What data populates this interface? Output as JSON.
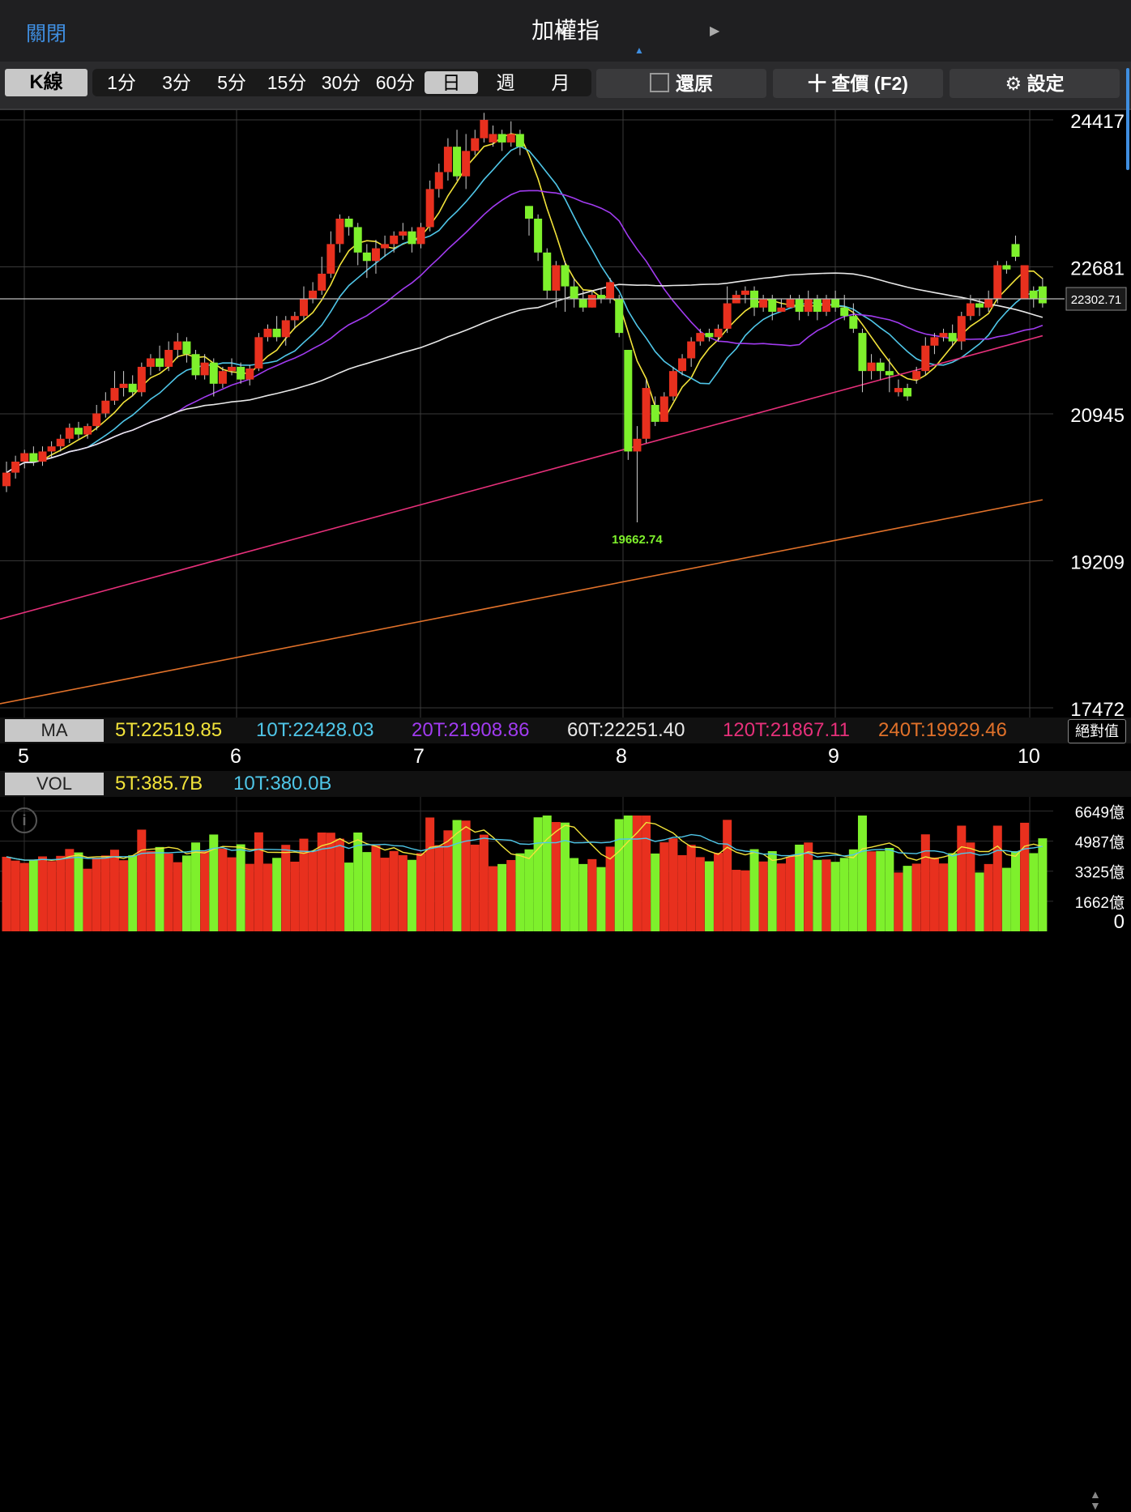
{
  "header": {
    "close_label": "關閉",
    "title": "加權指",
    "prev_arrow": "◀",
    "next_arrow": "▶",
    "caret": "▲"
  },
  "toolbar": {
    "kline_label": "K線",
    "intervals": [
      "1分",
      "3分",
      "5分",
      "15分",
      "30分",
      "60分",
      "日",
      "週",
      "月"
    ],
    "selected_interval": "日",
    "restore_label": "還原",
    "quote_label": "十 查價 (F2)",
    "settings_label": "設定",
    "settings_icon": "gear-icon"
  },
  "chart_data": {
    "type": "candlestick",
    "price_axis_ticks": [
      24417,
      22681,
      20945,
      19209,
      17472
    ],
    "ylim": [
      17472,
      24417
    ],
    "current_price": "22302.71",
    "high_label": "24416.67",
    "low_label": "19662.74",
    "date_labels": [
      "5",
      "6",
      "7",
      "8",
      "9",
      "10"
    ],
    "candles": [
      [
        20090,
        20250,
        20380,
        20020
      ],
      [
        20250,
        20380,
        20450,
        20180
      ],
      [
        20380,
        20480,
        20520,
        20300
      ],
      [
        20480,
        20380,
        20560,
        20330
      ],
      [
        20380,
        20500,
        20560,
        20330
      ],
      [
        20500,
        20560,
        20620,
        20430
      ],
      [
        20560,
        20650,
        20700,
        20500
      ],
      [
        20650,
        20780,
        20830,
        20600
      ],
      [
        20780,
        20700,
        20850,
        20650
      ],
      [
        20700,
        20800,
        20830,
        20650
      ],
      [
        20800,
        20950,
        21050,
        20750
      ],
      [
        20950,
        21100,
        21200,
        20900
      ],
      [
        21100,
        21250,
        21450,
        21050
      ],
      [
        21250,
        21300,
        21450,
        21150
      ],
      [
        21300,
        21200,
        21400,
        21150
      ],
      [
        21200,
        21500,
        21550,
        21150
      ],
      [
        21500,
        21600,
        21650,
        21400
      ],
      [
        21600,
        21500,
        21750,
        21450
      ],
      [
        21500,
        21700,
        21800,
        21450
      ],
      [
        21700,
        21800,
        21900,
        21600
      ],
      [
        21800,
        21650,
        21850,
        21550
      ],
      [
        21650,
        21400,
        21700,
        21350
      ],
      [
        21400,
        21550,
        21650,
        21350
      ],
      [
        21550,
        21300,
        21600,
        21150
      ],
      [
        21300,
        21450,
        21500,
        21250
      ],
      [
        21450,
        21500,
        21600,
        21400
      ],
      [
        21500,
        21350,
        21550,
        21300
      ],
      [
        21350,
        21480,
        21520,
        21280
      ],
      [
        21480,
        21850,
        21900,
        21450
      ],
      [
        21850,
        21950,
        22000,
        21800
      ],
      [
        21950,
        21850,
        22100,
        21800
      ],
      [
        21850,
        22050,
        22100,
        21750
      ],
      [
        22050,
        22100,
        22150,
        21950
      ],
      [
        22100,
        22300,
        22450,
        22050
      ],
      [
        22300,
        22400,
        22500,
        22250
      ],
      [
        22400,
        22600,
        22800,
        22350
      ],
      [
        22600,
        22950,
        23100,
        22550
      ],
      [
        22950,
        23250,
        23300,
        22850
      ],
      [
        23250,
        23150,
        23280,
        23050
      ],
      [
        23150,
        22850,
        23200,
        22700
      ],
      [
        22850,
        22750,
        22950,
        22550
      ],
      [
        22750,
        22900,
        23000,
        22600
      ],
      [
        22900,
        22950,
        23050,
        22800
      ],
      [
        22950,
        23050,
        23100,
        22850
      ],
      [
        23050,
        23100,
        23200,
        23000
      ],
      [
        23100,
        22950,
        23150,
        22850
      ],
      [
        22950,
        23150,
        23200,
        22900
      ],
      [
        23150,
        23600,
        23700,
        23100
      ],
      [
        23600,
        23800,
        23900,
        23500
      ],
      [
        23800,
        24100,
        24200,
        23700
      ],
      [
        24100,
        23750,
        24300,
        23700
      ],
      [
        23750,
        24050,
        24250,
        23600
      ],
      [
        24050,
        24200,
        24300,
        24000
      ],
      [
        24200,
        24416.67,
        24500,
        24150
      ],
      [
        24150,
        24250,
        24350,
        24100
      ],
      [
        24250,
        24150,
        24300,
        24050
      ],
      [
        24150,
        24250,
        24400,
        24100
      ],
      [
        24250,
        24100,
        24300,
        24000
      ],
      [
        23400,
        23250,
        23400,
        23050
      ],
      [
        23250,
        22850,
        23300,
        22750
      ],
      [
        22850,
        22400,
        22900,
        22300
      ],
      [
        22400,
        22700,
        22750,
        22200
      ],
      [
        22700,
        22450,
        22750,
        22150
      ],
      [
        22450,
        22300,
        22550,
        22200
      ],
      [
        22300,
        22200,
        22400,
        22150
      ],
      [
        22200,
        22350,
        22400,
        22200
      ],
      [
        22350,
        22300,
        22420,
        22250
      ],
      [
        22300,
        22500,
        22550,
        22250
      ],
      [
        22300,
        21900,
        22350,
        21850
      ],
      [
        21700,
        20500,
        21700,
        20400
      ],
      [
        20500,
        20650,
        20800,
        19662.74
      ],
      [
        20650,
        21250,
        21350,
        20600
      ],
      [
        21050,
        20850,
        21150,
        20800
      ],
      [
        20850,
        21150,
        21200,
        20850
      ],
      [
        21150,
        21450,
        21500,
        21100
      ],
      [
        21450,
        21600,
        21650,
        21400
      ],
      [
        21600,
        21800,
        21850,
        21500
      ],
      [
        21800,
        21900,
        21950,
        21750
      ],
      [
        21900,
        21850,
        21950,
        21800
      ],
      [
        21850,
        21950,
        22000,
        21800
      ],
      [
        21950,
        22250,
        22450,
        21900
      ],
      [
        22250,
        22350,
        22400,
        22250
      ],
      [
        22350,
        22400,
        22450,
        22250
      ],
      [
        22400,
        22200,
        22450,
        22100
      ],
      [
        22200,
        22300,
        22350,
        22150
      ],
      [
        22300,
        22150,
        22350,
        22050
      ],
      [
        22150,
        22200,
        22300,
        22150
      ],
      [
        22200,
        22300,
        22350,
        22200
      ],
      [
        22300,
        22150,
        22350,
        22050
      ],
      [
        22150,
        22300,
        22400,
        22100
      ],
      [
        22300,
        22150,
        22350,
        22050
      ],
      [
        22150,
        22300,
        22350,
        22100
      ],
      [
        22300,
        22200,
        22400,
        22150
      ],
      [
        22200,
        22100,
        22350,
        22050
      ],
      [
        22100,
        21950,
        22250,
        21900
      ],
      [
        21900,
        21450,
        21950,
        21200
      ],
      [
        21450,
        21550,
        21650,
        21350
      ],
      [
        21550,
        21450,
        21600,
        21350
      ],
      [
        21450,
        21400,
        21600,
        21200
      ],
      [
        21200,
        21250,
        21350,
        21150
      ],
      [
        21250,
        21150,
        21300,
        21100
      ],
      [
        21350,
        21450,
        21500,
        21300
      ],
      [
        21450,
        21750,
        21850,
        21400
      ],
      [
        21750,
        21850,
        21900,
        21650
      ],
      [
        21850,
        21900,
        21950,
        21800
      ],
      [
        21900,
        21800,
        22000,
        21750
      ],
      [
        21800,
        22100,
        22150,
        21700
      ],
      [
        22100,
        22250,
        22350,
        22050
      ],
      [
        22250,
        22200,
        22300,
        22100
      ],
      [
        22200,
        22300,
        22400,
        22150
      ],
      [
        22300,
        22700,
        22750,
        22250
      ],
      [
        22700,
        22650,
        22750,
        22600
      ],
      [
        22950,
        22800,
        23050,
        22750
      ],
      [
        22300,
        22700,
        22700,
        22300
      ],
      [
        22400,
        22300,
        22450,
        22200
      ],
      [
        22450,
        22250,
        22550,
        22200
      ]
    ],
    "ma_values": {
      "ma5": "5T:22519.85",
      "ma10": "10T:22428.03",
      "ma20": "20T:21908.86",
      "ma60": "60T:22251.40",
      "ma120": "120T:21867.11",
      "ma240": "240T:19929.46"
    },
    "ma_colors": {
      "ma5": "#f2e33a",
      "ma10": "#4fc6e8",
      "ma20": "#a13bf0",
      "ma60": "#e8e8e8",
      "ma120": "#e6307a",
      "ma240": "#e0712a"
    },
    "vol_axis_ticks": [
      "6649億",
      "4987億",
      "3325億",
      "1662億",
      "0"
    ],
    "vol_max": 6649,
    "vol_ma": {
      "v5": "5T:385.7B",
      "v10": "10T:380.0B"
    },
    "up_color": "#e8301e",
    "down_color": "#7ef02c"
  },
  "ma_label": "MA",
  "vol_label": "VOL",
  "abs_label": "絕對值"
}
